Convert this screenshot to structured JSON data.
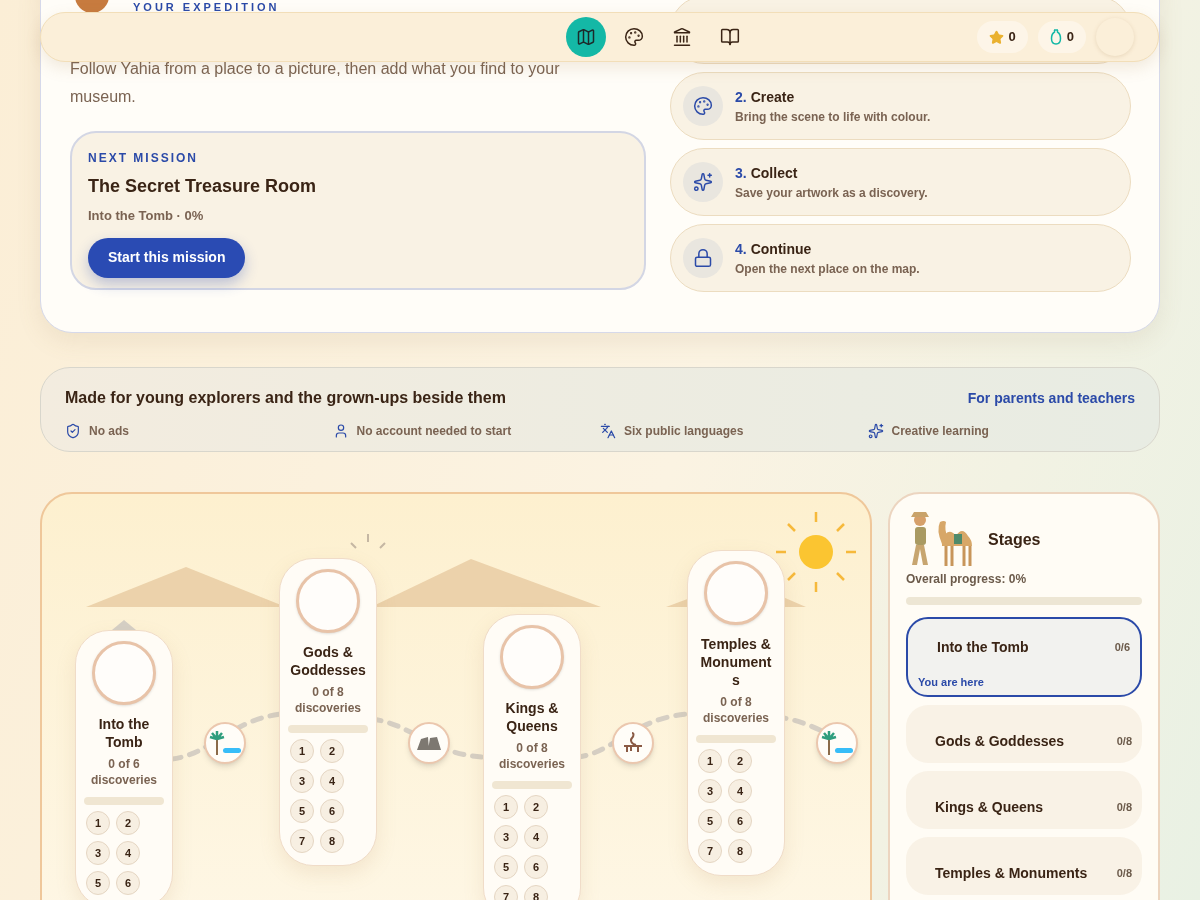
{
  "nav": {
    "items": [
      {
        "kind": "map",
        "selected": true
      },
      {
        "kind": "palette",
        "selected": false
      },
      {
        "kind": "museum",
        "selected": false
      },
      {
        "kind": "book",
        "selected": false
      }
    ],
    "counters": [
      {
        "kind": "star",
        "value": "0"
      },
      {
        "kind": "vase",
        "value": "0"
      }
    ]
  },
  "hero": {
    "eyebrow": "YOUR EXPEDITION",
    "intro": "Follow Yahia from a place to a picture, then add what you find to your museum.",
    "next_mission": {
      "label": "NEXT MISSION",
      "title": "The Secret Treasure Room",
      "meta": "Into the Tomb · 0%",
      "button": "Start this mission"
    },
    "steps": [
      {
        "kind": "hidden"
      },
      {
        "kind": "palette",
        "number": "2.",
        "title": "Create",
        "description": "Bring the scene to life with colour."
      },
      {
        "kind": "sparkles",
        "number": "3.",
        "title": "Collect",
        "description": "Save your artwork as a discovery."
      },
      {
        "kind": "lock",
        "number": "4.",
        "title": "Continue",
        "description": "Open the next place on the map."
      }
    ]
  },
  "trust": {
    "title": "Made for young explorers and the grown-ups beside them",
    "link": "For parents and teachers",
    "features": [
      {
        "kind": "shield",
        "label": "No ads"
      },
      {
        "kind": "user",
        "label": "No account needed to start"
      },
      {
        "kind": "languages",
        "label": "Six public languages"
      },
      {
        "kind": "sparkles",
        "label": "Creative learning"
      }
    ]
  },
  "map": {
    "stages": [
      {
        "name": "Into the Tomb",
        "progress": "0 of 6 discoveries",
        "level": 0,
        "slots": [
          "1",
          "2",
          "3",
          "4",
          "5",
          "6"
        ]
      },
      {
        "name": "Gods & Goddesses",
        "progress": "0 of 8 discoveries",
        "level": 0,
        "slots": [
          "1",
          "2",
          "3",
          "4",
          "5",
          "6",
          "7",
          "8"
        ]
      },
      {
        "name": "Kings & Queens",
        "progress": "0 of 8 discoveries",
        "level": 0,
        "slots": [
          "1",
          "2",
          "3",
          "4",
          "5",
          "6",
          "7",
          "8"
        ]
      },
      {
        "name": "Temples & Monuments",
        "progress": "0 of 8 discoveries",
        "level": 0,
        "slots": [
          "1",
          "2",
          "3",
          "4",
          "5",
          "6",
          "7",
          "8"
        ]
      }
    ],
    "connectors": [
      {
        "kind": "oasis"
      },
      {
        "kind": "rocks"
      },
      {
        "kind": "heron"
      },
      {
        "kind": "oasis"
      }
    ]
  },
  "sidebar": {
    "title": "Stages",
    "overall": "Overall progress: 0%",
    "level": 0,
    "items": [
      {
        "name": "Into the Tomb",
        "count": "0/6",
        "selected": true,
        "note": "You are here"
      },
      {
        "name": "Gods & Goddesses",
        "count": "0/8",
        "selected": false
      },
      {
        "name": "Kings & Queens",
        "count": "0/8",
        "selected": false
      },
      {
        "name": "Temples & Monuments",
        "count": "0/8",
        "selected": false
      }
    ]
  }
}
